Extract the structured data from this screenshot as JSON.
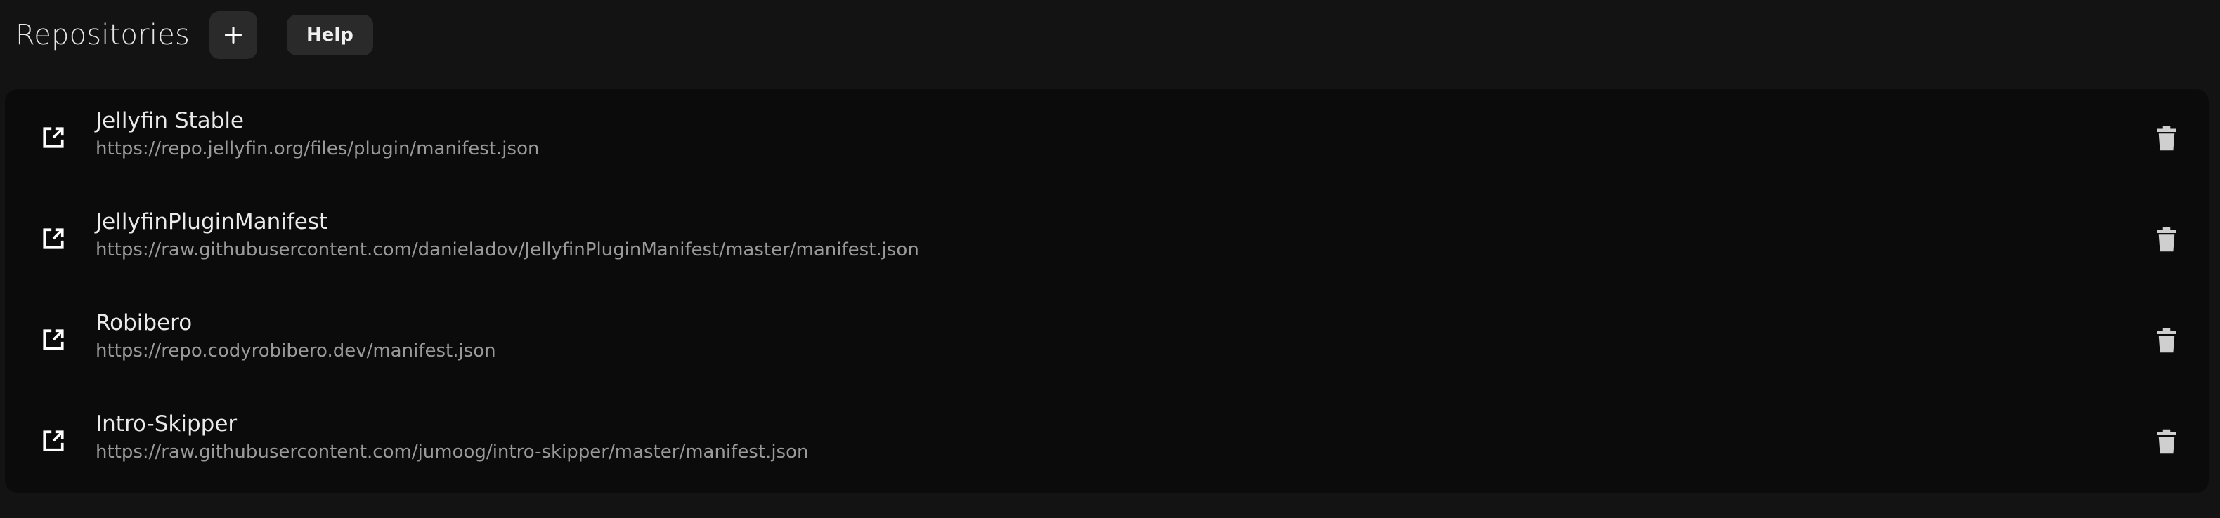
{
  "header": {
    "title": "Repositories",
    "add_icon": "plus-icon",
    "help_label": "Help"
  },
  "repositories": [
    {
      "name": "Jellyfin Stable",
      "url": "https://repo.jellyfin.org/files/plugin/manifest.json"
    },
    {
      "name": "JellyfinPluginManifest",
      "url": "https://raw.githubusercontent.com/danieladov/JellyfinPluginManifest/master/manifest.json"
    },
    {
      "name": "Robibero",
      "url": "https://repo.codyrobibero.dev/manifest.json"
    },
    {
      "name": "Intro-Skipper",
      "url": "https://raw.githubusercontent.com/jumoog/intro-skipper/master/manifest.json"
    }
  ],
  "icons": {
    "open": "open-in-new-icon",
    "delete": "trash-icon"
  },
  "colors": {
    "background": "#131313",
    "list_background": "#0b0b0b",
    "button_background": "#2a2a2a",
    "url_text": "#9a9a9a"
  }
}
